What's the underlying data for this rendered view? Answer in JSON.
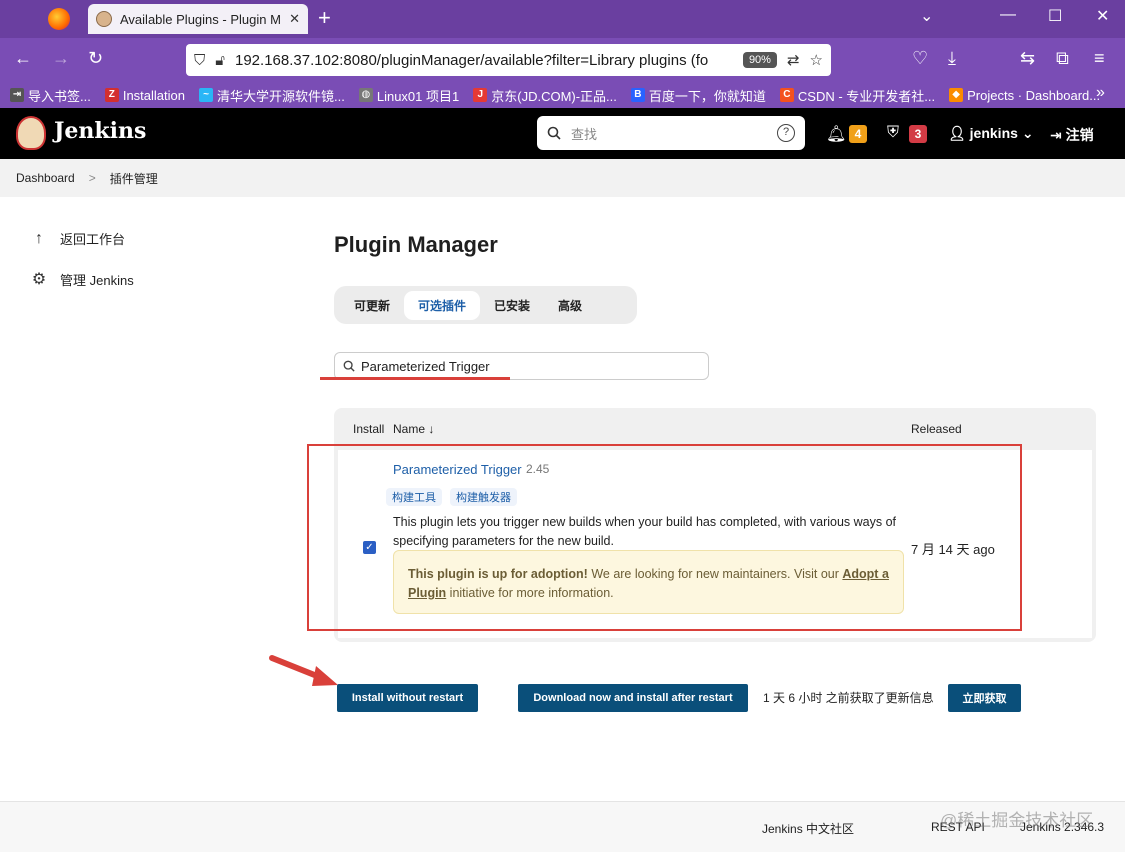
{
  "browser": {
    "tab_title": "Available Plugins - Plugin Ma",
    "url": "192.168.37.102:8080/pluginManager/available?filter=Library plugins (fo",
    "zoom": "90%",
    "bookmarks": [
      {
        "label": "导入书签...",
        "icon_color": "#555"
      },
      {
        "label": "Installation",
        "icon_color": "#d32f2f"
      },
      {
        "label": "清华大学开源软件镜...",
        "icon_color": "#29b6f6"
      },
      {
        "label": "Linux01 项目1",
        "icon_color": "#777"
      },
      {
        "label": "京东(JD.COM)-正品...",
        "icon_color": "#e53935"
      },
      {
        "label": "百度一下，你就知道",
        "icon_color": "#2962ff"
      },
      {
        "label": "CSDN - 专业开发者社...",
        "icon_color": "#f4511e"
      },
      {
        "label": "Projects · Dashboard...",
        "icon_color": "#fb8c00"
      }
    ]
  },
  "header": {
    "brand": "Jenkins",
    "search_placeholder": "查找",
    "help": "?",
    "notifications": "4",
    "security": "3",
    "user": "jenkins",
    "logout": "注销"
  },
  "breadcrumb": {
    "root": "Dashboard",
    "sep": ">",
    "current": "插件管理"
  },
  "sidebar": {
    "items": [
      {
        "label": "返回工作台",
        "icon": "up-arrow-icon"
      },
      {
        "label": "管理 Jenkins",
        "icon": "gear-icon"
      }
    ]
  },
  "main": {
    "title": "Plugin Manager",
    "tabs": [
      "可更新",
      "可选插件",
      "已安装",
      "高级"
    ],
    "active_tab": "可选插件",
    "search_value": "Parameterized Trigger",
    "table": {
      "headers": {
        "install": "Install",
        "name": "Name ↓",
        "released": "Released"
      },
      "row": {
        "name": "Parameterized Trigger",
        "version": "2.45",
        "tags": [
          "构建工具",
          "构建触发器"
        ],
        "description": "This plugin lets you trigger new builds when your build has completed, with various ways of specifying parameters for the new build.",
        "adoption_bold": "This plugin is up for adoption!",
        "adoption_text1": " We are looking for new maintainers. Visit our ",
        "adoption_link": "Adopt a Plugin",
        "adoption_text2": " initiative for more information.",
        "released": "7 月 14 天 ago",
        "checked": true
      }
    },
    "buttons": {
      "install": "Install without restart",
      "download": "Download now and install after restart",
      "fetch": "立即获取"
    },
    "update_info": "1 天 6 小时 之前获取了更新信息"
  },
  "footer": {
    "community": "Jenkins 中文社区",
    "rest": "REST API",
    "version": "Jenkins 2.346.3",
    "watermark": "@稀土掘金技术社区"
  },
  "colors": {
    "accent": "#0a4f7a",
    "highlight": "#d9403a",
    "browser": "#7a4db5"
  }
}
